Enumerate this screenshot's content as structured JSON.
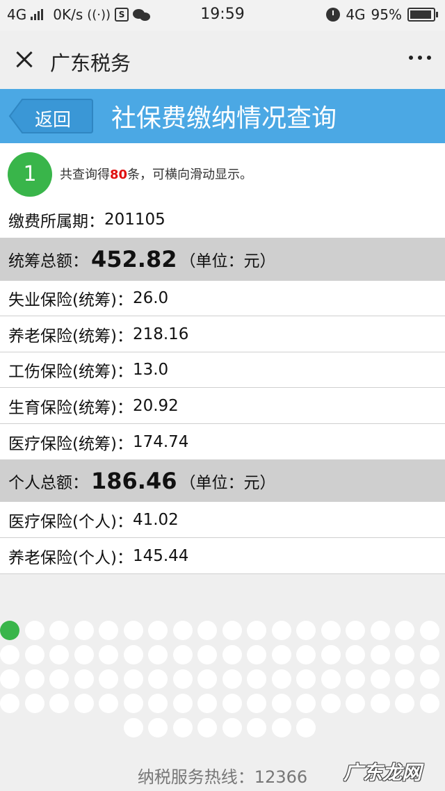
{
  "status_bar": {
    "network": "4G",
    "speed": "0K/s",
    "time": "19:59",
    "network_right": "4G",
    "battery": "95%",
    "battery_level": 0.95
  },
  "title_bar": {
    "title": "广东税务"
  },
  "page_header": {
    "back_label": "返回",
    "title": "社保费缴纳情况查询"
  },
  "result": {
    "step_number": "1",
    "count_prefix": "共查询得",
    "count": "80",
    "count_suffix": "条，可横向滑动显示。"
  },
  "period": {
    "label": "缴费所属期：",
    "value": "201105"
  },
  "pooled_total": {
    "label": "统筹总额：",
    "value": "452.82",
    "unit": "（单位：元）"
  },
  "pooled_items": [
    {
      "label": "失业保险(统筹)：",
      "value": "26.0"
    },
    {
      "label": "养老保险(统筹)：",
      "value": "218.16"
    },
    {
      "label": "工伤保险(统筹)：",
      "value": "13.0"
    },
    {
      "label": "生育保险(统筹)：",
      "value": "20.92"
    },
    {
      "label": "医疗保险(统筹)：",
      "value": "174.74"
    }
  ],
  "personal_total": {
    "label": "个人总额：",
    "value": "186.46",
    "unit": "（单位：元）"
  },
  "personal_items": [
    {
      "label": "医疗保险(个人)：",
      "value": "41.02"
    },
    {
      "label": "养老保险(个人)：",
      "value": "145.44"
    }
  ],
  "pagination": {
    "total_pages": 80,
    "current_page": 1
  },
  "footer": {
    "hotline": "纳税服务热线：12366"
  },
  "watermark": "广东龙网",
  "colors": {
    "header_blue": "#4ba8e4",
    "accent_green": "#39b54a",
    "count_red": "#e01010",
    "total_row_gray": "#cfcfcf"
  }
}
